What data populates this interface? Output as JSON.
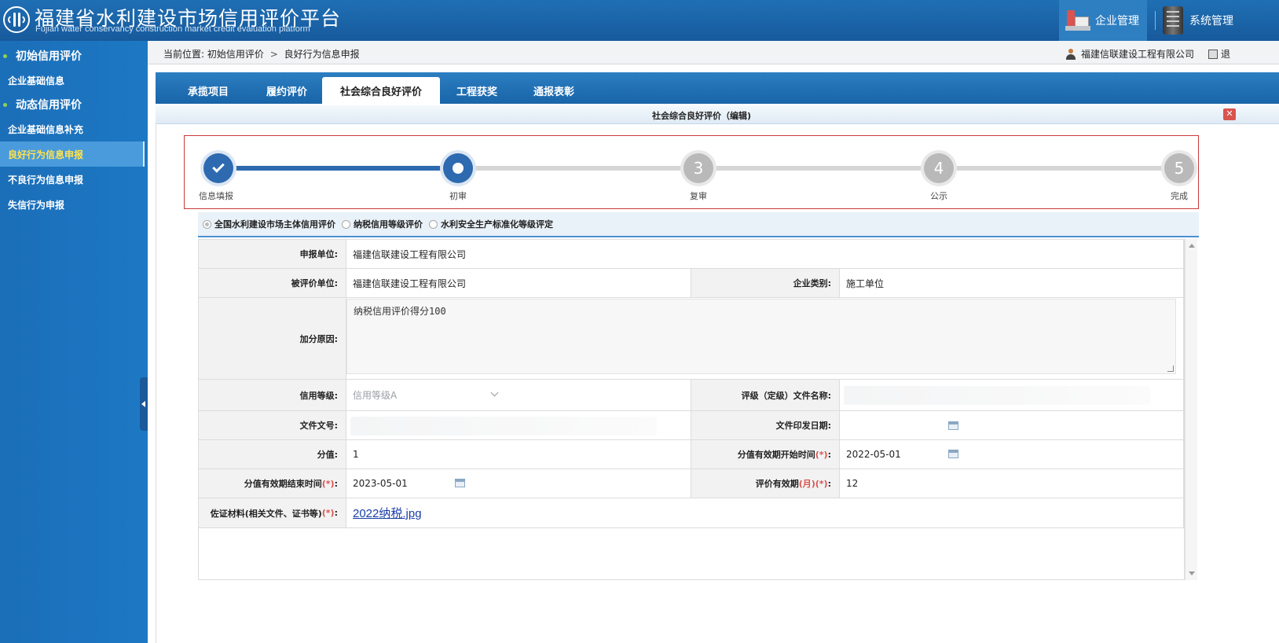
{
  "header": {
    "title": "福建省水利建设市场信用评价平台",
    "subtitle": "Fujian water conservancy construction market credit evaluation platform",
    "nav": [
      {
        "label": "企业管理",
        "icon": "enterprise-icon",
        "active": true
      },
      {
        "label": "系统管理",
        "icon": "server-icon",
        "active": false
      }
    ]
  },
  "sidebar": {
    "groups": [
      {
        "label": "初始信用评价",
        "items": [
          {
            "label": "企业基础信息"
          }
        ]
      },
      {
        "label": "动态信用评价",
        "items": [
          {
            "label": "企业基础信息补充"
          },
          {
            "label": "良好行为信息申报",
            "active": true
          },
          {
            "label": "不良行为信息申报"
          },
          {
            "label": "失信行为申报"
          }
        ]
      }
    ]
  },
  "breadcrumb": {
    "prefix": "当前位置:",
    "items": [
      "初始信用评价",
      "良好行为信息申报"
    ],
    "separator": ">"
  },
  "user": {
    "company": "福建信联建设工程有限公司",
    "logout": "退"
  },
  "tabs": [
    {
      "label": "承揽项目"
    },
    {
      "label": "履约评价"
    },
    {
      "label": "社会综合良好评价",
      "active": true
    },
    {
      "label": "工程获奖"
    },
    {
      "label": "通报表彰"
    }
  ],
  "panel": {
    "title": "社会综合良好评价（编辑)",
    "close": "✕"
  },
  "steps": [
    {
      "label": "信息填报",
      "status": "done",
      "number": ""
    },
    {
      "label": "初审",
      "status": "current",
      "number": ""
    },
    {
      "label": "复审",
      "status": "todo",
      "number": "3"
    },
    {
      "label": "公示",
      "status": "todo",
      "number": "4"
    },
    {
      "label": "完成",
      "status": "todo",
      "number": "5"
    }
  ],
  "radios": [
    {
      "label": "全国水利建设市场主体信用评价",
      "checked": true
    },
    {
      "label": "纳税信用等级评价",
      "checked": false
    },
    {
      "label": "水利安全生产标准化等级评定",
      "checked": false
    }
  ],
  "form": {
    "applicant_label": "申报单位:",
    "applicant": "福建信联建设工程有限公司",
    "evaluated_label": "被评价单位:",
    "evaluated": "福建信联建设工程有限公司",
    "category_label": "企业类别:",
    "category": "施工单位",
    "reason_label": "加分原因:",
    "reason": "纳税信用评价得分100",
    "credit_level_label": "信用等级:",
    "credit_level": "信用等级A",
    "doc_name_label": "评级（定级）文件名称:",
    "doc_name": "",
    "doc_no_label": "文件文号:",
    "doc_no": "",
    "issue_date_label": "文件印发日期:",
    "issue_date": "",
    "score_label": "分值:",
    "score": "1",
    "valid_start_label": "分值有效期开始时间",
    "valid_start": "2022-05-01",
    "valid_end_label": "分值有效期结束时间",
    "valid_end": "2023-05-01",
    "eval_period_label_a": "评价有效期",
    "eval_period_label_month": "月",
    "eval_period": "12",
    "evidence_label": "佐证材料(相关文件、证书等)",
    "evidence_file": "2022纳税.jpg",
    "req_mark": "(*)",
    "colon": ":",
    "paren_open": "(",
    "paren_close": ")"
  }
}
